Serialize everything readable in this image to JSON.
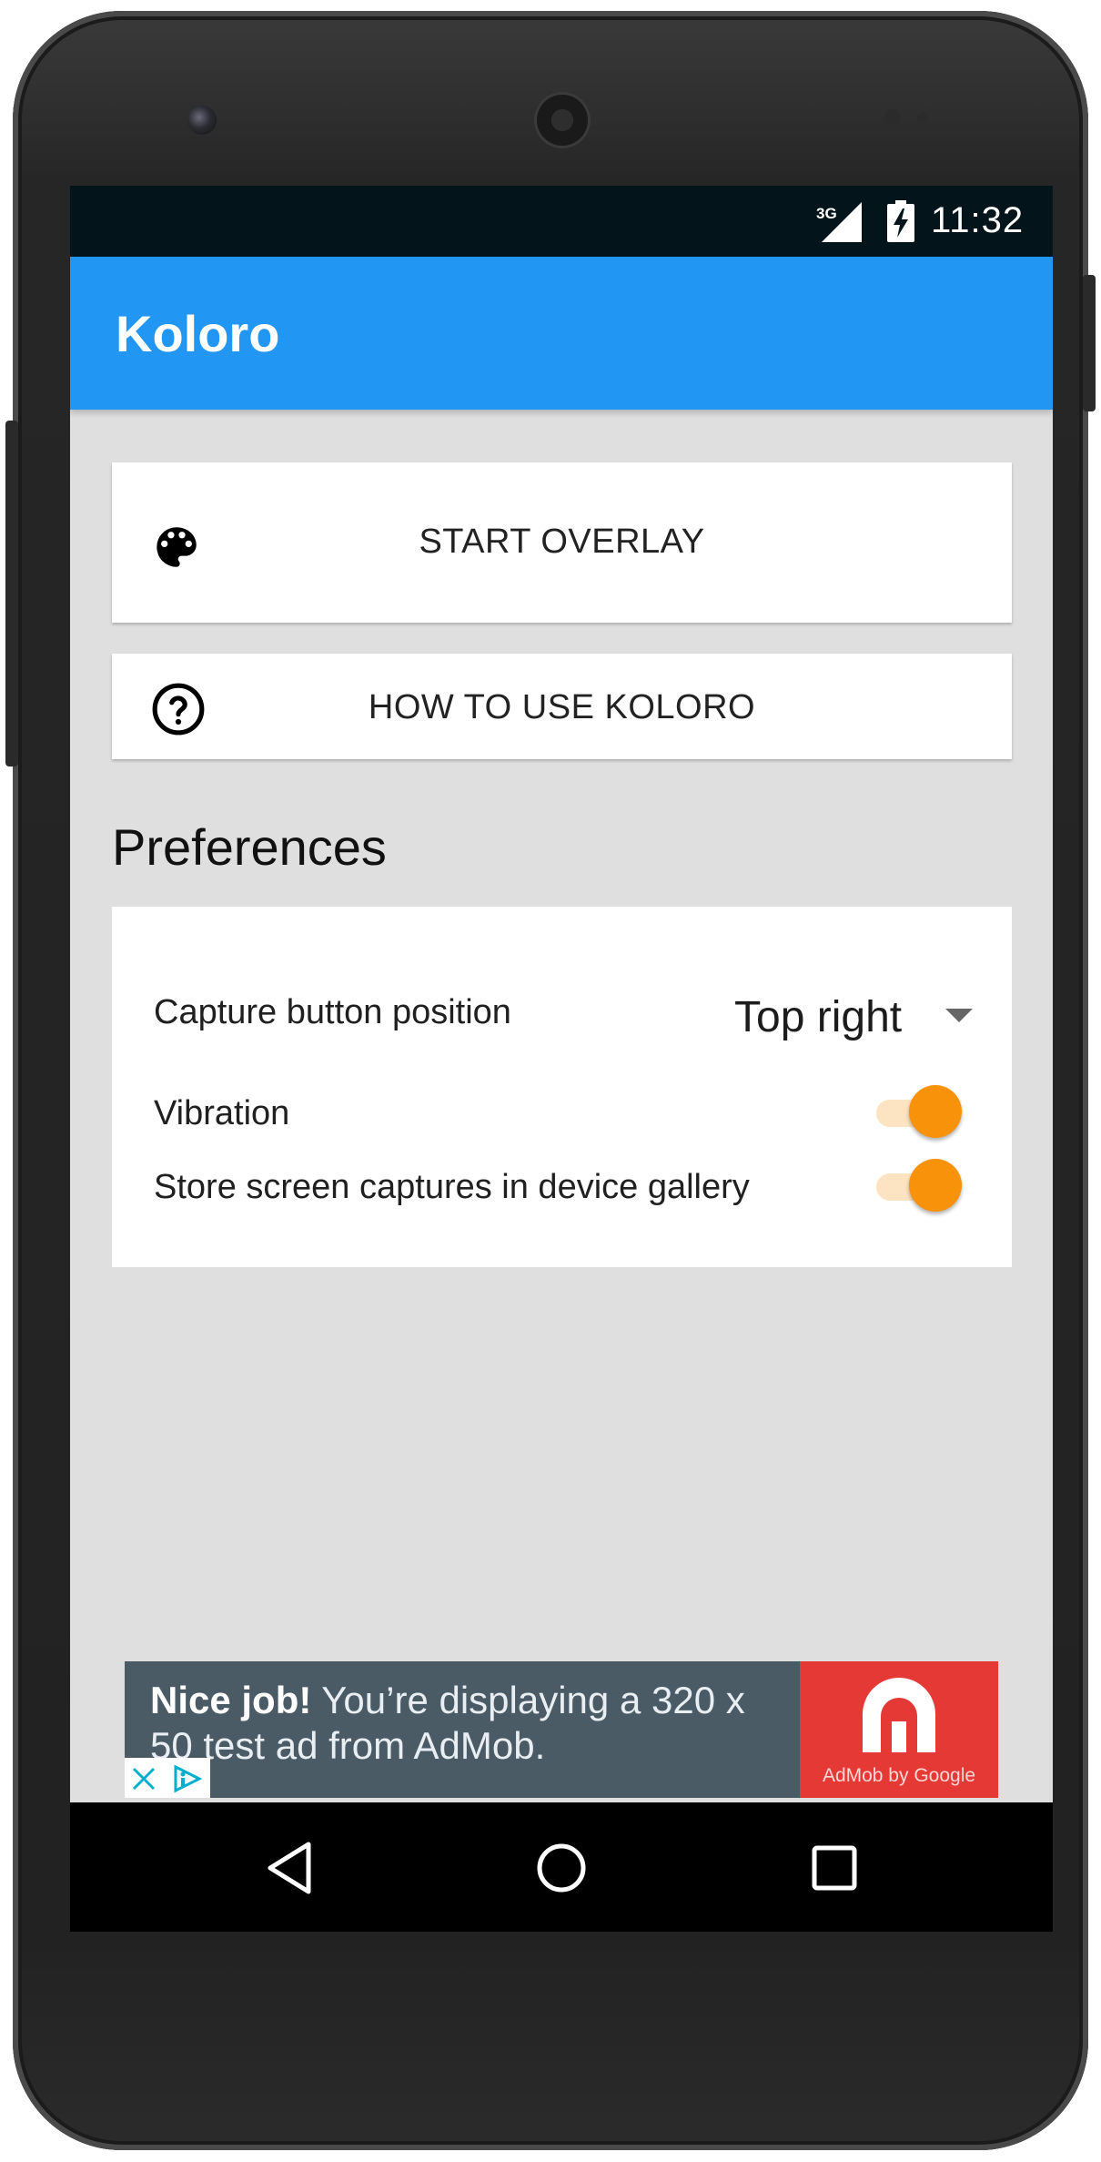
{
  "status_bar": {
    "network": "3G",
    "time": "11:32"
  },
  "app_bar": {
    "title": "Koloro"
  },
  "actions": {
    "start_overlay": "START OVERLAY",
    "how_to_use": "HOW TO USE KOLORO"
  },
  "preferences": {
    "title": "Preferences",
    "capture_position_label": "Capture button position",
    "capture_position_value": "Top right",
    "vibration_label": "Vibration",
    "vibration_on": true,
    "store_gallery_label": "Store screen captures in device gallery",
    "store_gallery_on": true
  },
  "ad": {
    "headline": "Nice job!",
    "body": " You’re displaying a 320 x 50 test ad from AdMob.",
    "brand": "AdMob by Google"
  },
  "nav": {
    "back": "back-icon",
    "home": "home-icon",
    "recents": "recents-icon"
  },
  "colors": {
    "app_bar": "#2196f3",
    "switch_thumb": "#f9920b",
    "switch_track": "#fce3c2",
    "background": "#e0dfe0",
    "ad_background": "#4a5b66",
    "ad_logo": "#e53935"
  }
}
